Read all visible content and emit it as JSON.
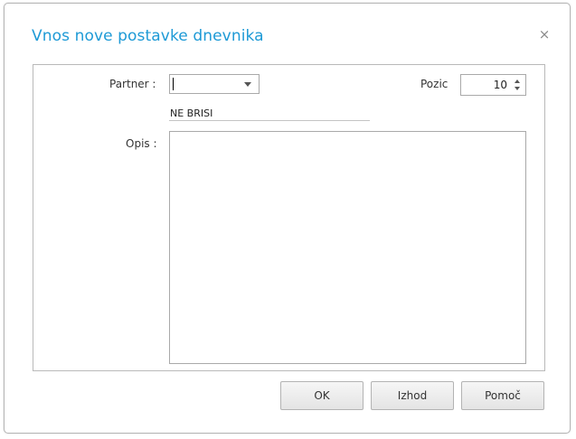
{
  "dialog": {
    "title": "Vnos nove postavke dnevnika",
    "close_glyph": "×"
  },
  "form": {
    "partner_label": "Partner :",
    "partner_value": "",
    "partner_name": "NE BRISI",
    "pozic_label": "Pozic",
    "pozic_value": "10",
    "opis_label": "Opis :",
    "opis_value": ""
  },
  "buttons": {
    "ok": "OK",
    "izhod": "Izhod",
    "pomoc": "Pomoč"
  },
  "colors": {
    "title": "#1e9ad6",
    "border": "#b9b9b9"
  },
  "icons": {
    "close": "close-icon",
    "dropdown": "chevron-down-icon",
    "spinner": "spinner-arrows-icon"
  }
}
